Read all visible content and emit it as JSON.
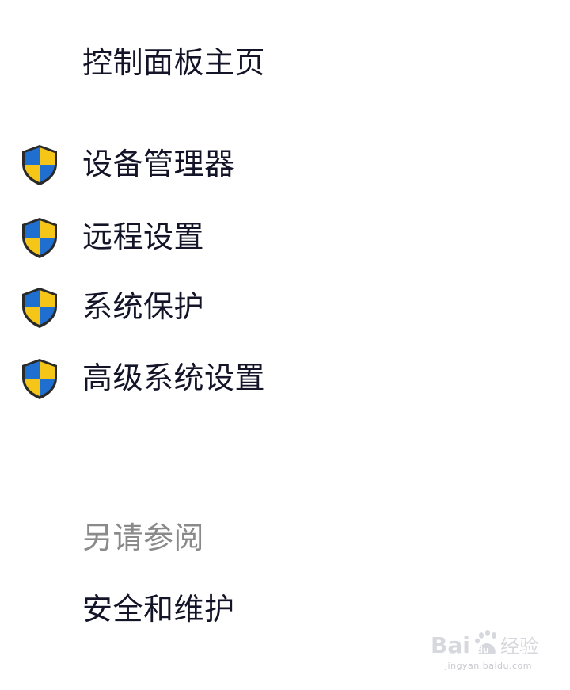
{
  "nav": {
    "home_label": "控制面板主页"
  },
  "tasks": [
    {
      "label": "设备管理器",
      "icon": "uac-shield-icon"
    },
    {
      "label": "远程设置",
      "icon": "uac-shield-icon"
    },
    {
      "label": "系统保护",
      "icon": "uac-shield-icon"
    },
    {
      "label": "高级系统设置",
      "icon": "uac-shield-icon"
    }
  ],
  "see_also": {
    "heading": "另请参阅",
    "items": [
      {
        "label": "安全和维护"
      }
    ]
  },
  "watermark": {
    "logo_text": "Bai 经验",
    "url": "jingyan.baidu.com"
  },
  "colors": {
    "shield_blue": "#1f6fd1",
    "shield_yellow": "#f5c518",
    "shield_outline": "#2a2a2a",
    "link_text": "#141428",
    "heading_gray": "#8a8a8a"
  }
}
